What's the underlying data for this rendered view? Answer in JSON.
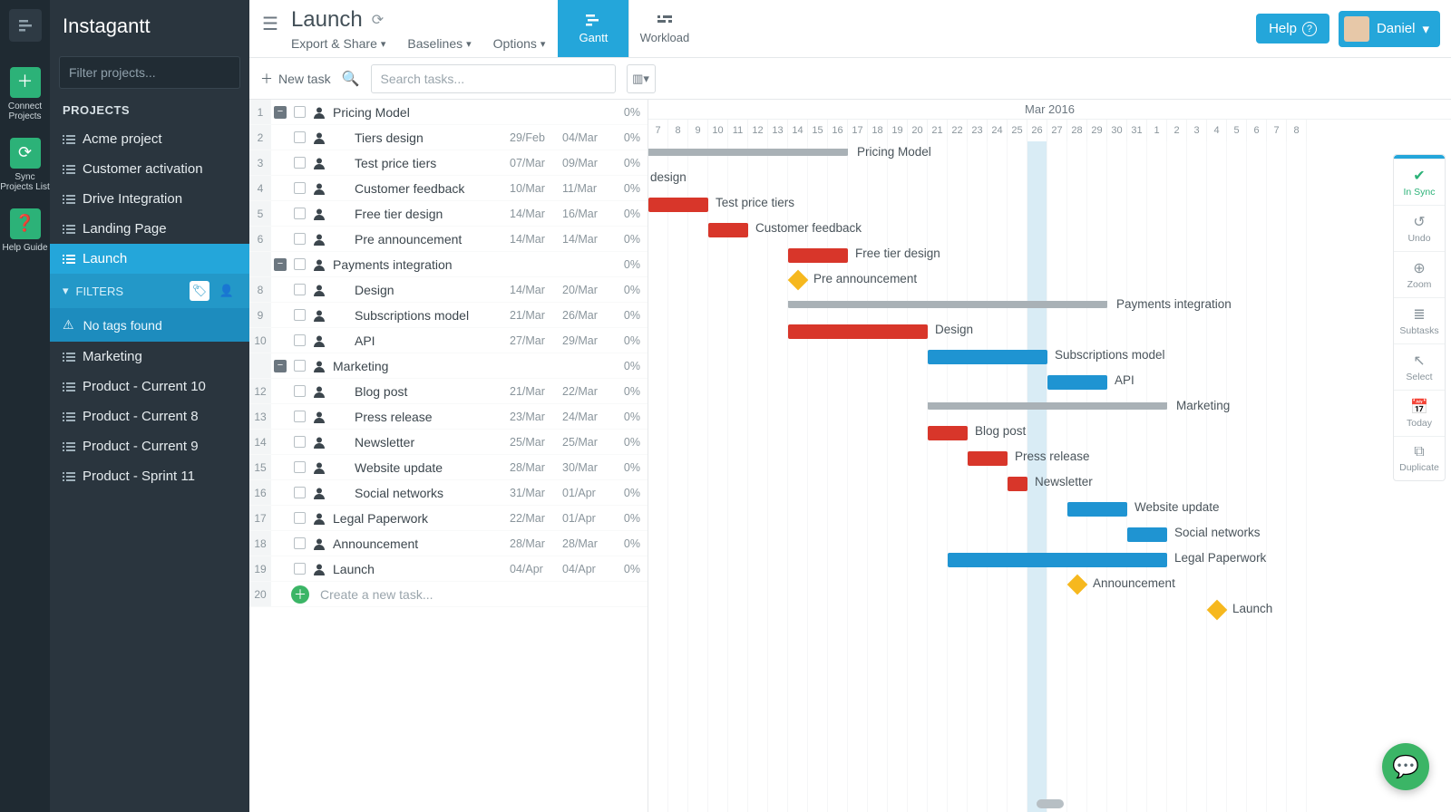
{
  "brand": "Instagantt",
  "rail": {
    "connect": "Connect Projects",
    "sync": "Sync Projects List",
    "help": "Help Guide"
  },
  "sidebar": {
    "filter_placeholder": "Filter projects...",
    "header": "PROJECTS",
    "items": [
      {
        "label": "Acme project"
      },
      {
        "label": "Customer activation"
      },
      {
        "label": "Drive Integration"
      },
      {
        "label": "Landing Page"
      },
      {
        "label": "Launch",
        "active": true
      },
      {
        "label": "Marketing"
      },
      {
        "label": "Product - Current 10"
      },
      {
        "label": "Product - Current 8"
      },
      {
        "label": "Product - Current 9"
      },
      {
        "label": "Product - Sprint 11"
      }
    ],
    "filters_label": "FILTERS",
    "no_tags": "No tags found"
  },
  "header": {
    "title": "Launch",
    "menus": [
      "Export & Share",
      "Baselines",
      "Options"
    ],
    "tabs": {
      "gantt": "Gantt",
      "workload": "Workload"
    },
    "help": "Help",
    "user": "Daniel"
  },
  "subtop": {
    "new_task": "New task",
    "search_placeholder": "Search tasks..."
  },
  "timeline": {
    "month": "Mar 2016",
    "day_start": 7,
    "days": [
      "7",
      "8",
      "9",
      "10",
      "11",
      "12",
      "13",
      "14",
      "15",
      "16",
      "17",
      "18",
      "19",
      "20",
      "21",
      "22",
      "23",
      "24",
      "25",
      "26",
      "27",
      "28",
      "29",
      "30",
      "31",
      "1",
      "2",
      "3",
      "4",
      "5",
      "6",
      "7",
      "8"
    ],
    "today_index": 19
  },
  "tasks": [
    {
      "n": "1",
      "group": true,
      "name": "Pricing Model",
      "pct": "0%",
      "bar": {
        "type": "gray",
        "start": -6,
        "len": 16
      },
      "label": "Pricing Model"
    },
    {
      "n": "2",
      "sub": true,
      "name": "Tiers design",
      "d1": "29/Feb",
      "d2": "04/Mar",
      "pct": "0%",
      "bar": {
        "type": "red",
        "start": -6,
        "len": 4
      },
      "labelLeft": "design"
    },
    {
      "n": "3",
      "sub": true,
      "name": "Test price tiers",
      "d1": "07/Mar",
      "d2": "09/Mar",
      "pct": "0%",
      "bar": {
        "type": "red",
        "start": 0,
        "len": 3
      },
      "label": "Test price tiers"
    },
    {
      "n": "4",
      "sub": true,
      "name": "Customer feedback",
      "d1": "10/Mar",
      "d2": "11/Mar",
      "pct": "0%",
      "bar": {
        "type": "red",
        "start": 3,
        "len": 2
      },
      "label": "Customer feedback"
    },
    {
      "n": "5",
      "sub": true,
      "name": "Free tier design",
      "d1": "14/Mar",
      "d2": "16/Mar",
      "pct": "0%",
      "bar": {
        "type": "red",
        "start": 7,
        "len": 3
      },
      "label": "Free tier design"
    },
    {
      "n": "6",
      "sub": true,
      "name": "Pre announcement",
      "d1": "14/Mar",
      "d2": "14/Mar",
      "pct": "0%",
      "bar": {
        "type": "diamond",
        "start": 7
      },
      "label": "Pre announcement"
    },
    {
      "n": "",
      "group": true,
      "name": "Payments integration",
      "pct": "0%",
      "bar": {
        "type": "gray",
        "start": 7,
        "len": 16
      },
      "label": "Payments integration"
    },
    {
      "n": "8",
      "sub": true,
      "name": "Design",
      "d1": "14/Mar",
      "d2": "20/Mar",
      "pct": "0%",
      "bar": {
        "type": "red",
        "start": 7,
        "len": 7
      },
      "label": "Design"
    },
    {
      "n": "9",
      "sub": true,
      "name": "Subscriptions model",
      "d1": "21/Mar",
      "d2": "26/Mar",
      "pct": "0%",
      "bar": {
        "type": "blue",
        "start": 14,
        "len": 6
      },
      "label": "Subscriptions model"
    },
    {
      "n": "10",
      "sub": true,
      "name": "API",
      "d1": "27/Mar",
      "d2": "29/Mar",
      "pct": "0%",
      "bar": {
        "type": "blue",
        "start": 20,
        "len": 3
      },
      "label": "API"
    },
    {
      "n": "",
      "group": true,
      "name": "Marketing",
      "pct": "0%",
      "bar": {
        "type": "gray",
        "start": 14,
        "len": 12
      },
      "label": "Marketing"
    },
    {
      "n": "12",
      "sub": true,
      "name": "Blog post",
      "d1": "21/Mar",
      "d2": "22/Mar",
      "pct": "0%",
      "bar": {
        "type": "red",
        "start": 14,
        "len": 2
      },
      "label": "Blog post"
    },
    {
      "n": "13",
      "sub": true,
      "name": "Press release",
      "d1": "23/Mar",
      "d2": "24/Mar",
      "pct": "0%",
      "bar": {
        "type": "red",
        "start": 16,
        "len": 2
      },
      "label": "Press release"
    },
    {
      "n": "14",
      "sub": true,
      "name": "Newsletter",
      "d1": "25/Mar",
      "d2": "25/Mar",
      "pct": "0%",
      "bar": {
        "type": "red",
        "start": 18,
        "len": 1
      },
      "label": "Newsletter"
    },
    {
      "n": "15",
      "sub": true,
      "name": "Website update",
      "d1": "28/Mar",
      "d2": "30/Mar",
      "pct": "0%",
      "bar": {
        "type": "blue",
        "start": 21,
        "len": 3
      },
      "label": "Website update"
    },
    {
      "n": "16",
      "sub": true,
      "name": "Social networks",
      "d1": "31/Mar",
      "d2": "01/Apr",
      "pct": "0%",
      "bar": {
        "type": "blue",
        "start": 24,
        "len": 2
      },
      "label": "Social networks"
    },
    {
      "n": "17",
      "name": "Legal Paperwork",
      "d1": "22/Mar",
      "d2": "01/Apr",
      "pct": "0%",
      "bar": {
        "type": "blue",
        "start": 15,
        "len": 11
      },
      "label": "Legal Paperwork"
    },
    {
      "n": "18",
      "name": "Announcement",
      "d1": "28/Mar",
      "d2": "28/Mar",
      "pct": "0%",
      "bar": {
        "type": "diamond",
        "start": 21
      },
      "label": "Announcement"
    },
    {
      "n": "19",
      "name": "Launch",
      "d1": "04/Apr",
      "d2": "04/Apr",
      "pct": "0%",
      "bar": {
        "type": "diamond",
        "start": 28
      },
      "label": "Launch"
    },
    {
      "n": "20",
      "create": true,
      "name": "Create a new task..."
    }
  ],
  "right_rail": [
    {
      "label": "In Sync",
      "color": "green",
      "icon": "✔"
    },
    {
      "label": "Undo",
      "icon": "↺"
    },
    {
      "label": "Zoom",
      "icon": "⊕"
    },
    {
      "label": "Subtasks",
      "icon": "≣"
    },
    {
      "label": "Select",
      "icon": "↖"
    },
    {
      "label": "Today",
      "icon": "📅"
    },
    {
      "label": "Duplicate",
      "icon": "⧉"
    }
  ]
}
